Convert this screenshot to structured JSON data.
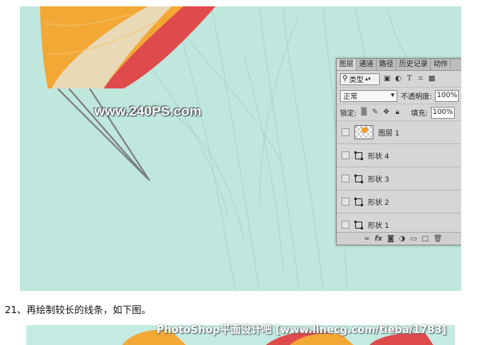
{
  "watermark": "www.240PS.com",
  "watermark_bottom": "PhotoShop平面设计吧 [www.linecg.com/tieba/1783]",
  "step_text": "21、再绘制较长的线条，如下图。",
  "colors": {
    "canvas_bg": "#bfe7de",
    "balloon_orange": "#f3a735",
    "balloon_cream": "#e9d9b6",
    "balloon_red": "#df4a4d",
    "line_gray": "#7b7b7b",
    "panel_bg": "#d6d6d6"
  },
  "panel": {
    "tabs": [
      "图层",
      "通道",
      "路径",
      "历史记录",
      "动作"
    ],
    "active_tab": 0,
    "kind_label": "类型",
    "kind_icon": "search-icon",
    "filter_icons": [
      "image-filter-icon",
      "adjustment-filter-icon",
      "type-filter-icon",
      "shape-filter-icon",
      "smart-object-filter-icon"
    ],
    "blend_mode": "正常",
    "opacity_label": "不透明度:",
    "opacity_value": "100%",
    "lock_label": "锁定:",
    "lock_icons": [
      "lock-transparency-icon",
      "lock-paint-icon",
      "lock-move-icon",
      "lock-all-icon"
    ],
    "fill_label": "填充:",
    "fill_value": "100%",
    "layers": [
      {
        "name": "图层 1",
        "type": "pixel"
      },
      {
        "name": "形状 4",
        "type": "shape"
      },
      {
        "name": "形状 3",
        "type": "shape"
      },
      {
        "name": "形状 2",
        "type": "shape"
      },
      {
        "name": "形状 1",
        "type": "shape"
      }
    ],
    "footer_icons": [
      "link-icon",
      "fx-icon",
      "mask-icon",
      "adjustment-icon",
      "group-folder-icon",
      "new-layer-icon",
      "trash-icon"
    ],
    "footer_fx": "fx"
  }
}
